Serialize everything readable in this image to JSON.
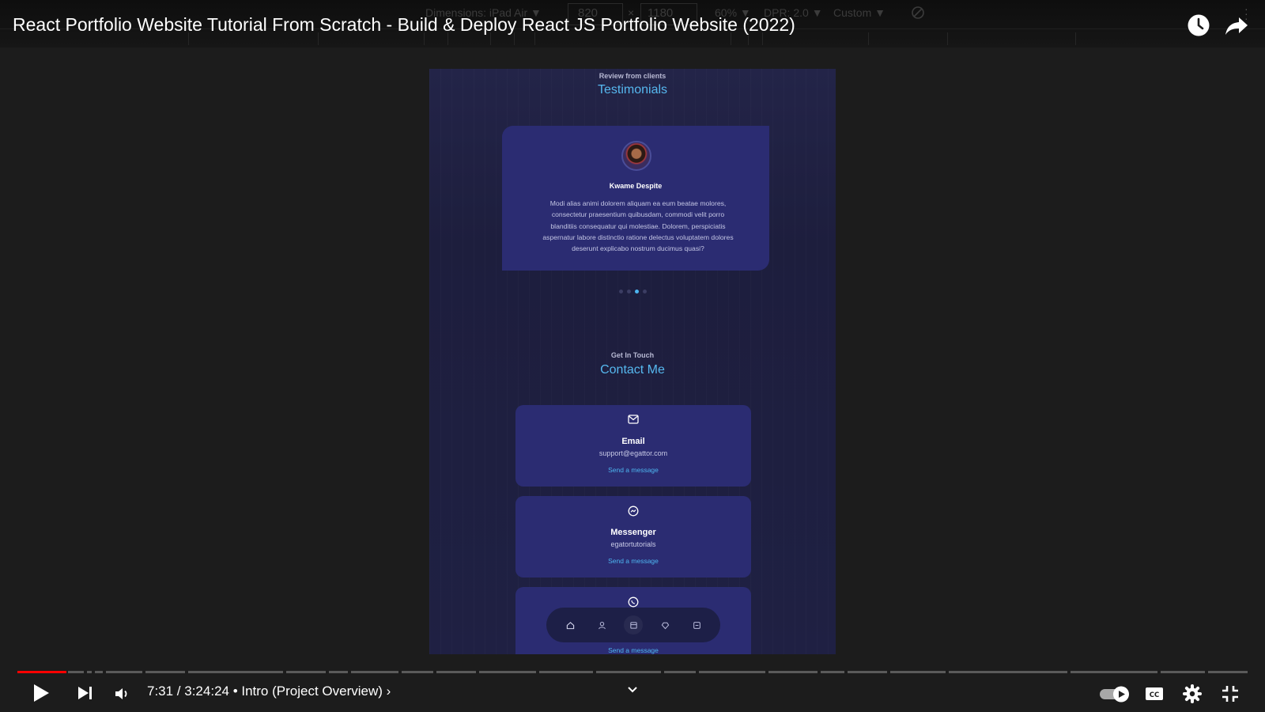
{
  "devtools": {
    "dimensions_label": "Dimensions: iPad Air ▼",
    "width_value": "820",
    "times": "×",
    "height_value": "1180",
    "zoom": "60% ▼",
    "dpr": "DPR: 2.0 ▼",
    "throttle": "Custom ▼"
  },
  "video": {
    "title": "React Portfolio Website Tutorial From Scratch - Build & Deploy React JS Portfolio Website (2022)"
  },
  "site": {
    "testimonials": {
      "subtitle": "Review from clients",
      "title": "Testimonials",
      "client_name": "Kwame Despite",
      "review": "Modi alias animi dolorem aliquam ea eum beatae molores, consectetur praesentium quibusdam, commodi velit porro blanditiis consequatur qui molestiae. Dolorem, perspiciatis aspernatur labore distinctio ratione delectus voluptatem dolores deserunt explicabo nostrum ducimus quasi?",
      "dots_total": 4,
      "active_dot": 3
    },
    "contact": {
      "subtitle": "Get In Touch",
      "title": "Contact Me",
      "options": [
        {
          "label": "Email",
          "value": "support@egattor.com",
          "link": "Send a message",
          "icon": "mail-icon"
        },
        {
          "label": "Messenger",
          "value": "egatortutorials",
          "link": "Send a message",
          "icon": "messenger-icon"
        },
        {
          "label": "",
          "value": "",
          "link": "Send a message",
          "icon": "whatsapp-icon"
        }
      ]
    },
    "nav": [
      "home-icon",
      "user-icon",
      "book-icon",
      "services-icon",
      "message-icon"
    ],
    "nav_active": "book-icon"
  },
  "player": {
    "current_time": "7:31",
    "duration": "3:24:24",
    "chapter": "Intro (Project Overview)",
    "time_text": "7:31 / 3:24:24 • Intro (Project Overview) ›",
    "progress_fraction": 0.038,
    "autoplay": true
  }
}
